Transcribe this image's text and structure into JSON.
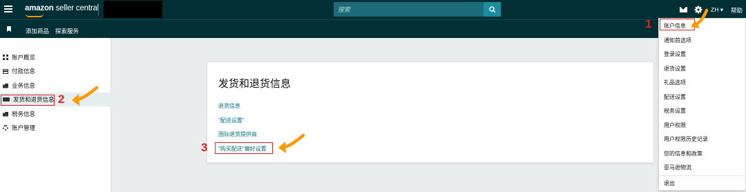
{
  "header": {
    "logo_bold": "amazon",
    "logo_light": "seller central",
    "search_placeholder": "搜索",
    "language": "ZH ▾",
    "help": "帮助"
  },
  "subnav": {
    "items": [
      "添加商品",
      "探索服务"
    ]
  },
  "sidebar": {
    "items": [
      {
        "label": "账户概览",
        "icon": "grid-icon"
      },
      {
        "label": "付款信息",
        "icon": "card-icon"
      },
      {
        "label": "业务信息",
        "icon": "building-icon"
      },
      {
        "label": "发货和退货信息",
        "icon": "truck-icon"
      },
      {
        "label": "税务信息",
        "icon": "building-icon"
      },
      {
        "label": "账户管理",
        "icon": "gear-icon"
      }
    ]
  },
  "main": {
    "title": "发货和退货信息",
    "links": [
      "退货信息",
      "\"配送设置\"",
      "国际退货提供商",
      "\"购买配送\"偏好设置"
    ]
  },
  "settings_menu": {
    "items": [
      "账户信息",
      "通知首选项",
      "登录设置",
      "退货设置",
      "礼品选项",
      "配送设置",
      "税务设置",
      "用户权限",
      "用户权限历史记录",
      "您的信息和政策",
      "亚马逊物流",
      "退出"
    ]
  },
  "annotations": {
    "step1": "1",
    "step2": "2",
    "step3": "3"
  },
  "colors": {
    "nav_bg": "#002f36",
    "accent": "#ff9900",
    "highlight_red": "#e02020",
    "link": "#007185"
  }
}
